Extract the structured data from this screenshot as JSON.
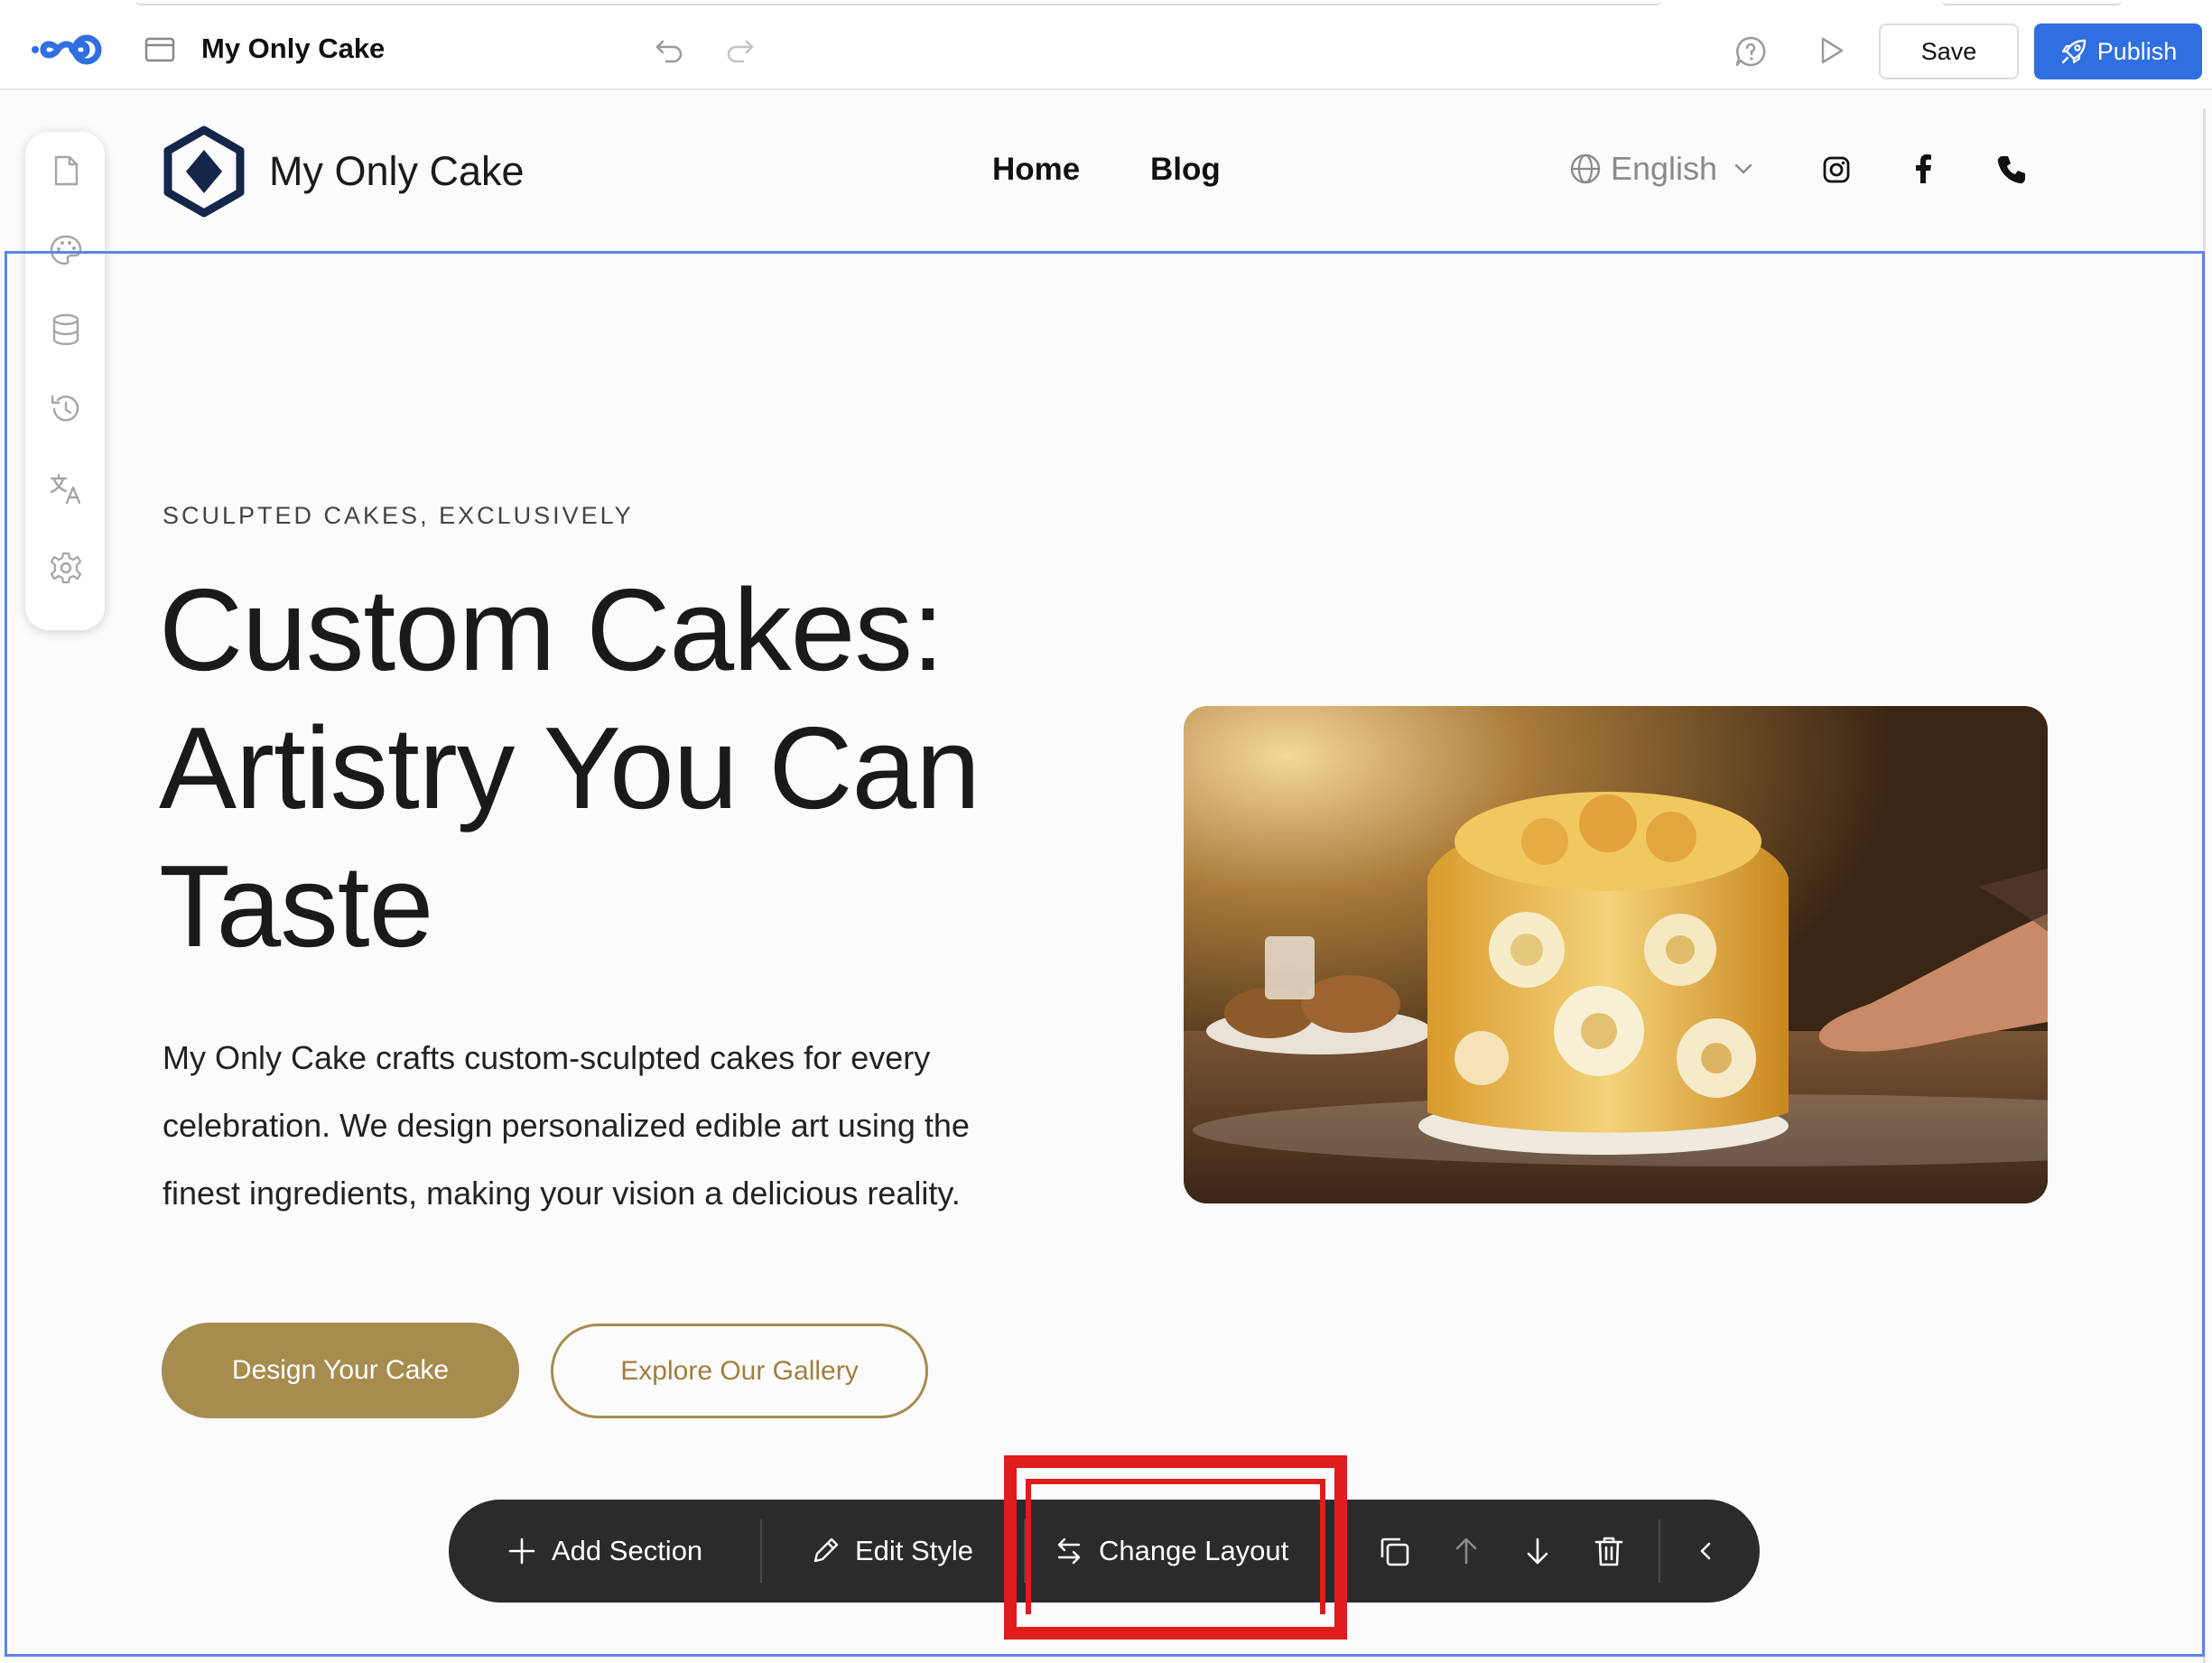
{
  "editor": {
    "site_title": "My Only Cake",
    "save_label": "Save",
    "publish_label": "Publish",
    "accent_color": "#2f6fe0",
    "icons": [
      "app-logo-icon",
      "page-icon",
      "undo-icon",
      "redo-icon",
      "help-chat-icon",
      "play-preview-icon",
      "rocket-icon"
    ]
  },
  "side_rail": {
    "items": [
      "pages-icon",
      "palette-icon",
      "database-icon",
      "history-icon",
      "translate-icon",
      "settings-icon"
    ]
  },
  "site_header": {
    "brand": "My Only Cake",
    "nav": [
      "Home",
      "Blog"
    ],
    "language": "English",
    "social_icons": [
      "instagram-icon",
      "facebook-icon",
      "phone-icon"
    ]
  },
  "hero": {
    "eyebrow": "SCULPTED CAKES, EXCLUSIVELY",
    "title": "Custom Cakes: Artistry You Can Taste",
    "body": "My Only Cake crafts custom-sculpted cakes for every celebration. We design personalized edible art using the finest ingredients, making your vision a delicious reality.",
    "primary_cta": "Design Your Cake",
    "secondary_cta": "Explore Our Gallery",
    "brand_color": "#a78c50"
  },
  "section_toolbar": {
    "add_section": "Add Section",
    "edit_style": "Edit Style",
    "change_layout": "Change Layout",
    "icons": [
      "duplicate-icon",
      "move-up-icon",
      "move-down-icon",
      "delete-icon",
      "collapse-icon"
    ]
  },
  "annotation": {
    "highlight_color": "#e01c1c"
  }
}
